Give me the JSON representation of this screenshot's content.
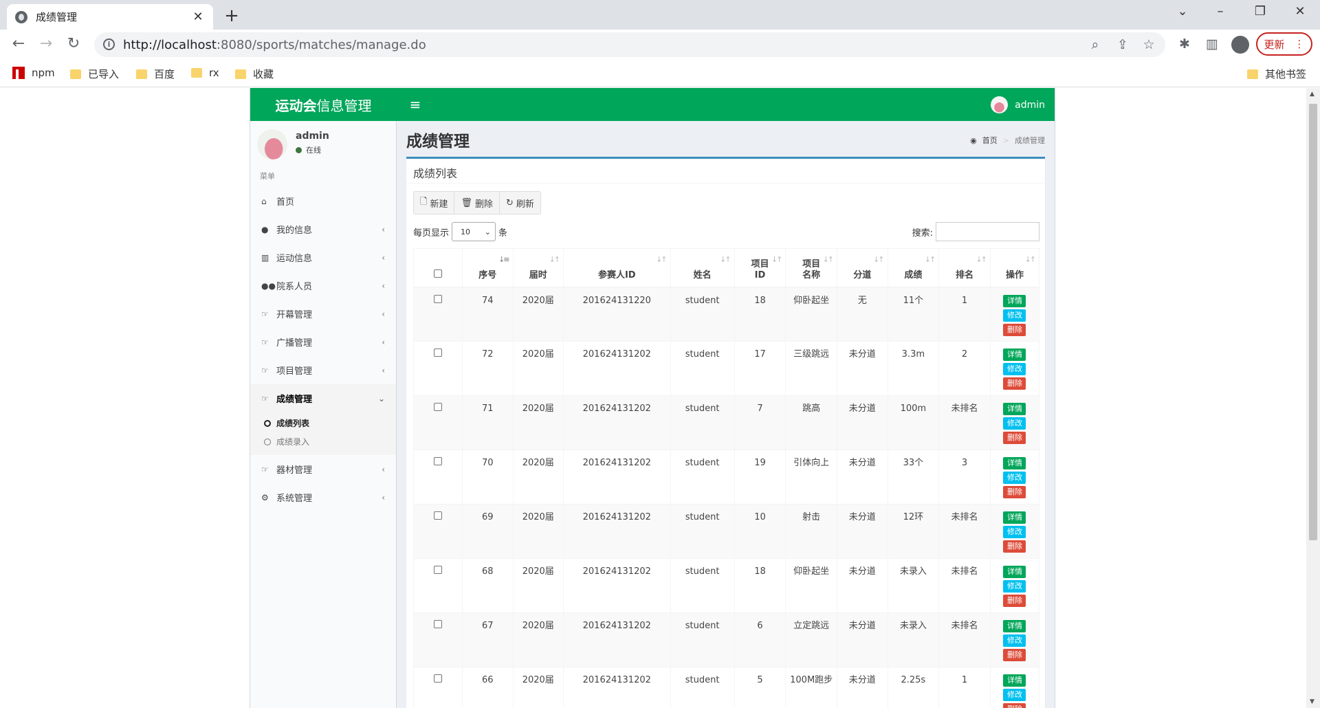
{
  "browser": {
    "tab_title": "成绩管理",
    "url_host": "http://localhost",
    "url_rest": ":8080/sports/matches/manage.do",
    "update_label": "更新",
    "bookmarks": [
      "npm",
      "已导入",
      "百度",
      "rx",
      "收藏"
    ],
    "other_bookmarks": "其他书签"
  },
  "header": {
    "logo_bold": "运动会",
    "logo_rest": "信息管理",
    "user": "admin"
  },
  "sidebar": {
    "user": "admin",
    "status": "在线",
    "menu_header": "菜单",
    "items": [
      {
        "label": "首页",
        "icon": "home-icon"
      },
      {
        "label": "我的信息",
        "icon": "user-icon"
      },
      {
        "label": "运动信息",
        "icon": "bar-chart-icon"
      },
      {
        "label": "院系人员",
        "icon": "users-icon"
      },
      {
        "label": "开幕管理",
        "icon": "hand-icon"
      },
      {
        "label": "广播管理",
        "icon": "hand-icon"
      },
      {
        "label": "项目管理",
        "icon": "hand-icon"
      },
      {
        "label": "成绩管理",
        "icon": "hand-icon"
      },
      {
        "label": "器材管理",
        "icon": "hand-icon"
      },
      {
        "label": "系统管理",
        "icon": "gear-icon"
      }
    ],
    "submenu": [
      "成绩列表",
      "成绩录入"
    ]
  },
  "content": {
    "title": "成绩管理",
    "breadcrumb_home": "首页",
    "breadcrumb_current": "成绩管理",
    "box_title": "成绩列表",
    "buttons": {
      "new": "新建",
      "delete": "删除",
      "refresh": "刷新"
    },
    "length_prefix": "每页显示",
    "length_value": "10",
    "length_suffix": "条",
    "search_label": "搜索:"
  },
  "table": {
    "headers": [
      "",
      "序号",
      "届时",
      "参赛人ID",
      "姓名",
      "项目ID",
      "项目名称",
      "分道",
      "成绩",
      "排名",
      "操作"
    ],
    "header_lines": {
      "project_id": [
        "项目",
        "ID"
      ],
      "project_name": [
        "项目",
        "名称"
      ]
    },
    "op_labels": {
      "detail": "详情",
      "edit": "修改",
      "delete": "删除"
    },
    "rows": [
      [
        "74",
        "2020届",
        "201624131220",
        "student",
        "18",
        "仰卧起坐",
        "无",
        "11个",
        "1"
      ],
      [
        "72",
        "2020届",
        "201624131202",
        "student",
        "17",
        "三级跳远",
        "未分道",
        "3.3m",
        "2"
      ],
      [
        "71",
        "2020届",
        "201624131202",
        "student",
        "7",
        "跳高",
        "未分道",
        "100m",
        "未排名"
      ],
      [
        "70",
        "2020届",
        "201624131202",
        "student",
        "19",
        "引体向上",
        "未分道",
        "33个",
        "3"
      ],
      [
        "69",
        "2020届",
        "201624131202",
        "student",
        "10",
        "射击",
        "未分道",
        "12环",
        "未排名"
      ],
      [
        "68",
        "2020届",
        "201624131202",
        "student",
        "18",
        "仰卧起坐",
        "未分道",
        "未录入",
        "未排名"
      ],
      [
        "67",
        "2020届",
        "201624131202",
        "student",
        "6",
        "立定跳远",
        "未分道",
        "未录入",
        "未排名"
      ],
      [
        "66",
        "2020届",
        "201624131202",
        "student",
        "5",
        "100M跑步",
        "未分道",
        "2.25s",
        "1"
      ]
    ]
  }
}
